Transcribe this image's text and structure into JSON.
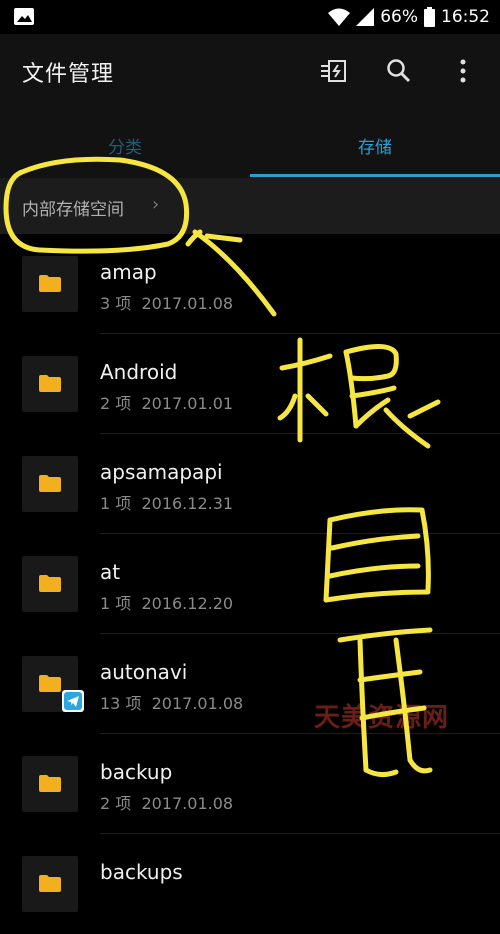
{
  "status_bar": {
    "battery": "66%",
    "time": "16:52",
    "icons": [
      "image-icon",
      "wifi-icon",
      "signal-icon",
      "battery-icon"
    ]
  },
  "app_bar": {
    "title": "文件管理",
    "actions": [
      "storage-analysis-icon",
      "search-icon",
      "more-icon"
    ]
  },
  "tabs": [
    {
      "label": "分类",
      "selected": false
    },
    {
      "label": "存储",
      "selected": true
    }
  ],
  "breadcrumb": {
    "path": "内部存储空间"
  },
  "files": [
    {
      "name": "amap",
      "count": "3 项",
      "date": "2017.01.08"
    },
    {
      "name": "Android",
      "count": "2 项",
      "date": "2017.01.01"
    },
    {
      "name": "apsamapapi",
      "count": "1 项",
      "date": "2016.12.31"
    },
    {
      "name": "at",
      "count": "1 项",
      "date": "2016.12.20"
    },
    {
      "name": "autonavi",
      "count": "13 项",
      "date": "2017.01.08",
      "badge": "telegram-app-icon"
    },
    {
      "name": "backup",
      "count": "2 项",
      "date": "2017.01.08"
    },
    {
      "name": "backups",
      "count": "",
      "date": ""
    }
  ],
  "watermark": "天美资源网",
  "colors": {
    "background": "#000000",
    "accent": "#2a9fd0",
    "folder": "#f2b01e",
    "annotation": "#f5e642",
    "watermark": "#c0392b"
  }
}
